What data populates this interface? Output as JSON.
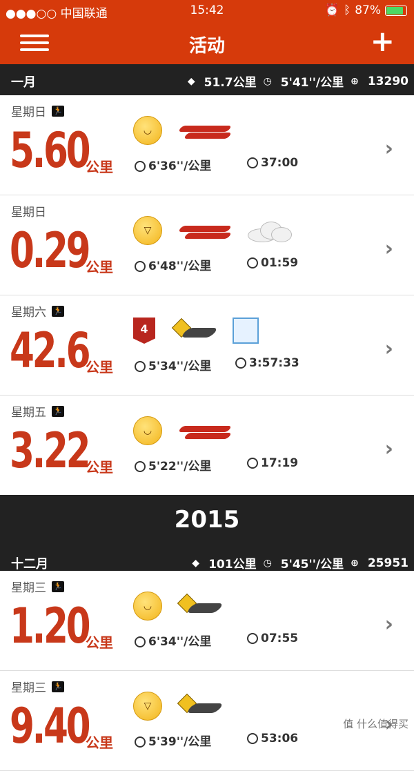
{
  "status": {
    "carrier": "●●●○○ 中国联通",
    "time": "15:42",
    "battery": "87%"
  },
  "nav": {
    "title": "活动"
  },
  "months": [
    {
      "name": "一月",
      "distance": "51.7公里",
      "pace": "5'41''/公里",
      "calories": "13290"
    },
    {
      "name": "十二月",
      "distance": "101公里",
      "pace": "5'45''/公里",
      "calories": "25951"
    }
  ],
  "year": "2015",
  "activities": [
    {
      "day": "星期日",
      "distance": "5.60",
      "unit": "公里",
      "pace": "6'36''/公里",
      "time": "37:00"
    },
    {
      "day": "星期日",
      "distance": "0.29",
      "unit": "公里",
      "pace": "6'48''/公里",
      "time": "01:59"
    },
    {
      "day": "星期六",
      "distance": "42.6",
      "unit": "公里",
      "pace": "5'34''/公里",
      "time": "3:57:33",
      "badge": "4"
    },
    {
      "day": "星期五",
      "distance": "3.22",
      "unit": "公里",
      "pace": "5'22''/公里",
      "time": "17:19"
    },
    {
      "day": "星期三",
      "distance": "1.20",
      "unit": "公里",
      "pace": "6'34''/公里",
      "time": "07:55"
    },
    {
      "day": "星期三",
      "distance": "9.40",
      "unit": "公里",
      "pace": "5'39''/公里",
      "time": "53:06"
    }
  ],
  "watermark": "值 什么值得买"
}
